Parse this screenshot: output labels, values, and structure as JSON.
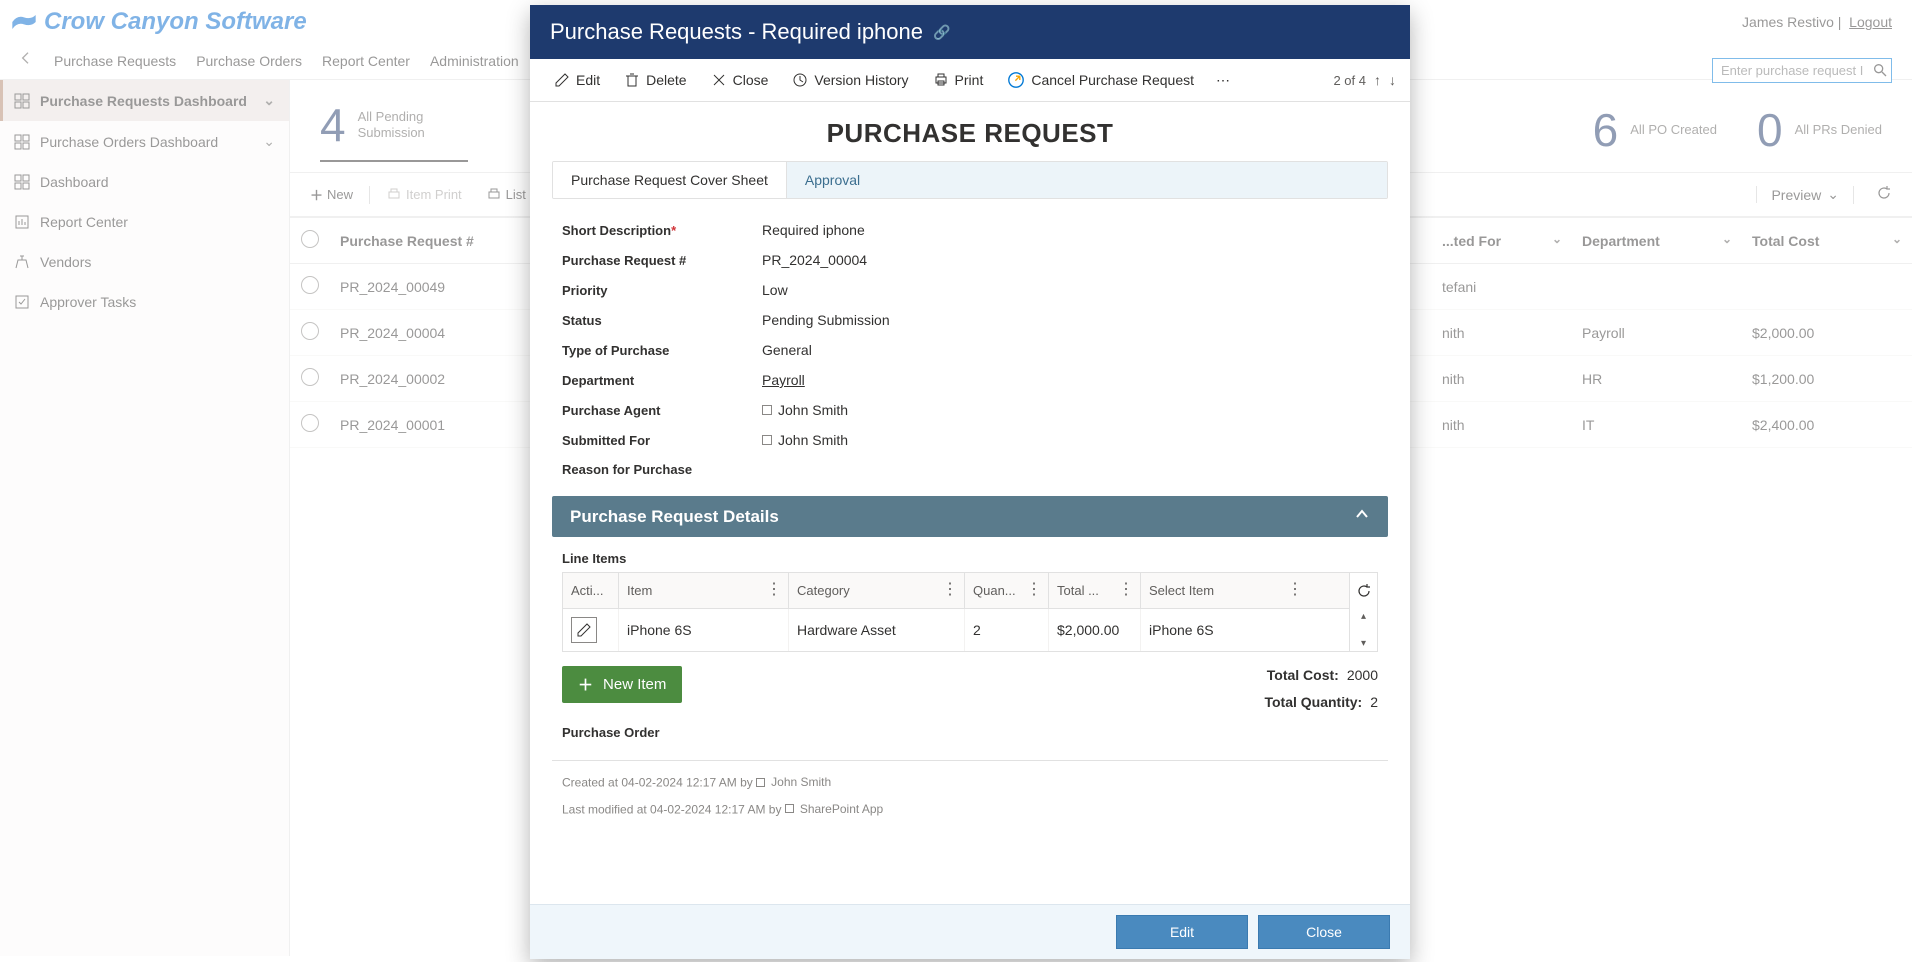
{
  "brand": "Crow Canyon Software",
  "user": {
    "name": "James Restivo",
    "logout": "Logout"
  },
  "topnav": [
    "Purchase Requests",
    "Purchase Orders",
    "Report Center",
    "Administration"
  ],
  "search_placeholder": "Enter purchase request I",
  "sidebar": [
    {
      "label": "Purchase Requests Dashboard",
      "icon": "grid",
      "expandable": true,
      "active": true
    },
    {
      "label": "Purchase Orders Dashboard",
      "icon": "grid",
      "expandable": true
    },
    {
      "label": "Dashboard",
      "icon": "grid"
    },
    {
      "label": "Report Center",
      "icon": "report"
    },
    {
      "label": "Vendors",
      "icon": "vendors"
    },
    {
      "label": "Approver Tasks",
      "icon": "check"
    }
  ],
  "counters": [
    {
      "num": "4",
      "label": "All Pending Submission"
    },
    {
      "num": "6",
      "label": "All PO Created"
    },
    {
      "num": "0",
      "label": "All PRs Denied"
    }
  ],
  "table_toolbar": {
    "new": "New",
    "item_print": "Item Print",
    "list_print": "List Print",
    "preview": "Preview"
  },
  "columns": [
    "Purchase Request #",
    "...ted For",
    "Department",
    "Total Cost"
  ],
  "rows": [
    {
      "id": "PR_2024_00049",
      "for": "tefani",
      "dept": "",
      "cost": ""
    },
    {
      "id": "PR_2024_00004",
      "for": "nith",
      "dept": "Payroll",
      "cost": "$2,000.00"
    },
    {
      "id": "PR_2024_00002",
      "for": "nith",
      "dept": "HR",
      "cost": "$1,200.00"
    },
    {
      "id": "PR_2024_00001",
      "for": "nith",
      "dept": "IT",
      "cost": "$2,400.00"
    }
  ],
  "dialog": {
    "header": "Purchase Requests - Required iphone",
    "toolbar": {
      "edit": "Edit",
      "delete": "Delete",
      "close": "Close",
      "version": "Version History",
      "print": "Print",
      "cancel_pr": "Cancel Purchase Request",
      "pager": "2 of 4"
    },
    "title": "PURCHASE REQUEST",
    "tabs": [
      "Purchase Request Cover Sheet",
      "Approval"
    ],
    "fields": {
      "short_desc_label": "Short Description",
      "short_desc": "Required iphone",
      "pr_num_label": "Purchase Request #",
      "pr_num": "PR_2024_00004",
      "priority_label": "Priority",
      "priority": "Low",
      "status_label": "Status",
      "status": "Pending Submission",
      "type_label": "Type of Purchase",
      "type": "General",
      "dept_label": "Department",
      "dept": "Payroll",
      "agent_label": "Purchase Agent",
      "agent": "John Smith",
      "for_label": "Submitted For",
      "for": "John Smith",
      "reason_label": "Reason for Purchase"
    },
    "section_hdr": "Purchase Request Details",
    "line_items_label": "Line Items",
    "line_cols": {
      "action": "Acti...",
      "item": "Item",
      "cat": "Category",
      "qty": "Quan...",
      "cost": "Total ...",
      "sel": "Select Item"
    },
    "line_row": {
      "item": "iPhone 6S",
      "cat": "Hardware Asset",
      "qty": "2",
      "cost": "$2,000.00",
      "sel": "iPhone 6S"
    },
    "new_item": "New Item",
    "total_cost_label": "Total Cost:",
    "total_cost": "2000",
    "total_qty_label": "Total Quantity:",
    "total_qty": "2",
    "po_label": "Purchase Order",
    "meta_created_prefix": "Created at 04-02-2024 12:17 AM by",
    "meta_created_by": "John Smith",
    "meta_modified_prefix": "Last modified at 04-02-2024 12:17 AM by",
    "meta_modified_by": "SharePoint App",
    "footer_edit": "Edit",
    "footer_close": "Close"
  }
}
